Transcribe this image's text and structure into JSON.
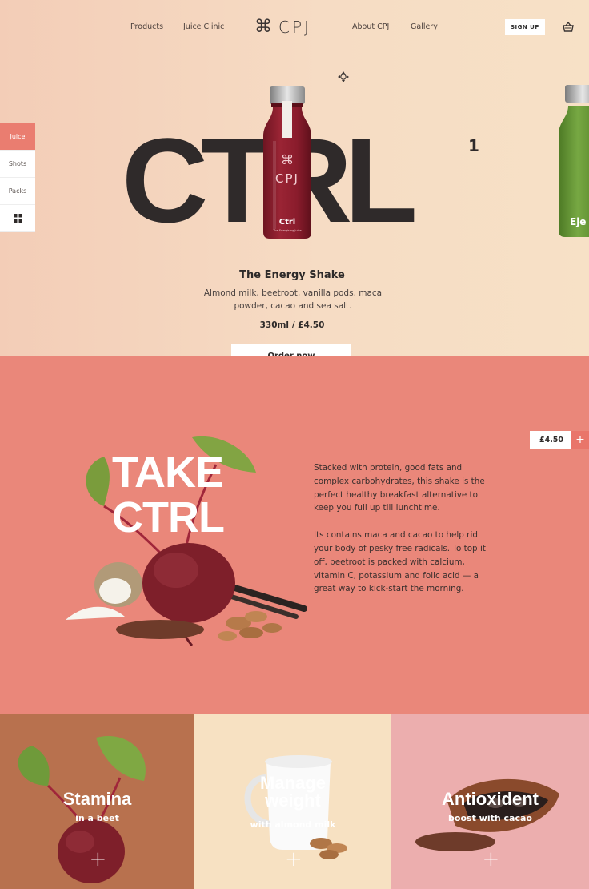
{
  "nav": {
    "products": "Products",
    "juice_clinic": "Juice Clinic",
    "logo_symbol": "⌘",
    "logo_text": "CPJ",
    "about": "About CPJ",
    "gallery": "Gallery",
    "signup": "SIGN UP",
    "basket_icon": "basket-icon"
  },
  "side_tabs": [
    {
      "label": "Juice",
      "active": true
    },
    {
      "label": "Shots",
      "active": false
    },
    {
      "label": "Packs",
      "active": false
    },
    {
      "label": "grid-icon",
      "active": false
    }
  ],
  "hero": {
    "headline": "CTRL",
    "superscript": "1",
    "bottle_label_brand": "CPJ",
    "bottle_label_name": "Ctrl",
    "bottle_label_tagline": "The Energising Juice",
    "next_bottle_name": "Eje",
    "product_title": "The Energy Shake",
    "product_description": "Almond milk, beetroot, vanilla pods, maca powder, cacao and sea salt.",
    "product_price": "330ml / £4.50",
    "order_button": "Order now"
  },
  "feature": {
    "price": "£4.50",
    "plus": "+",
    "headline_line1": "TAKE",
    "headline_line2": "CTRL",
    "paragraph1": "Stacked with protein, good fats and complex carbohydrates, this shake is the perfect healthy breakfast alternative to keep you full up till lunchtime.",
    "paragraph2": "Its contains maca and cacao to help rid your body of pesky free radicals. To top it off, beetroot is packed with calcium, vitamin C, potassium and folic acid — a great way to kick-start the morning."
  },
  "cards": [
    {
      "title": "Stamina",
      "subtitle": "in a beet",
      "plus": "+",
      "color": "#b8714e"
    },
    {
      "title_line1": "Manage",
      "title_line2": "weight",
      "subtitle": "with almond milk",
      "plus": "+",
      "color": "#f7e1c2"
    },
    {
      "title": "Antioxident",
      "subtitle": "boost with cacao",
      "plus": "+",
      "color": "#ecaeae"
    }
  ],
  "colors": {
    "coral": "#ea877a",
    "accent": "#e9756a",
    "dark": "#2f2a2a",
    "bottle_red": "#8b1d2c",
    "bottle_green": "#6a9a3a"
  }
}
